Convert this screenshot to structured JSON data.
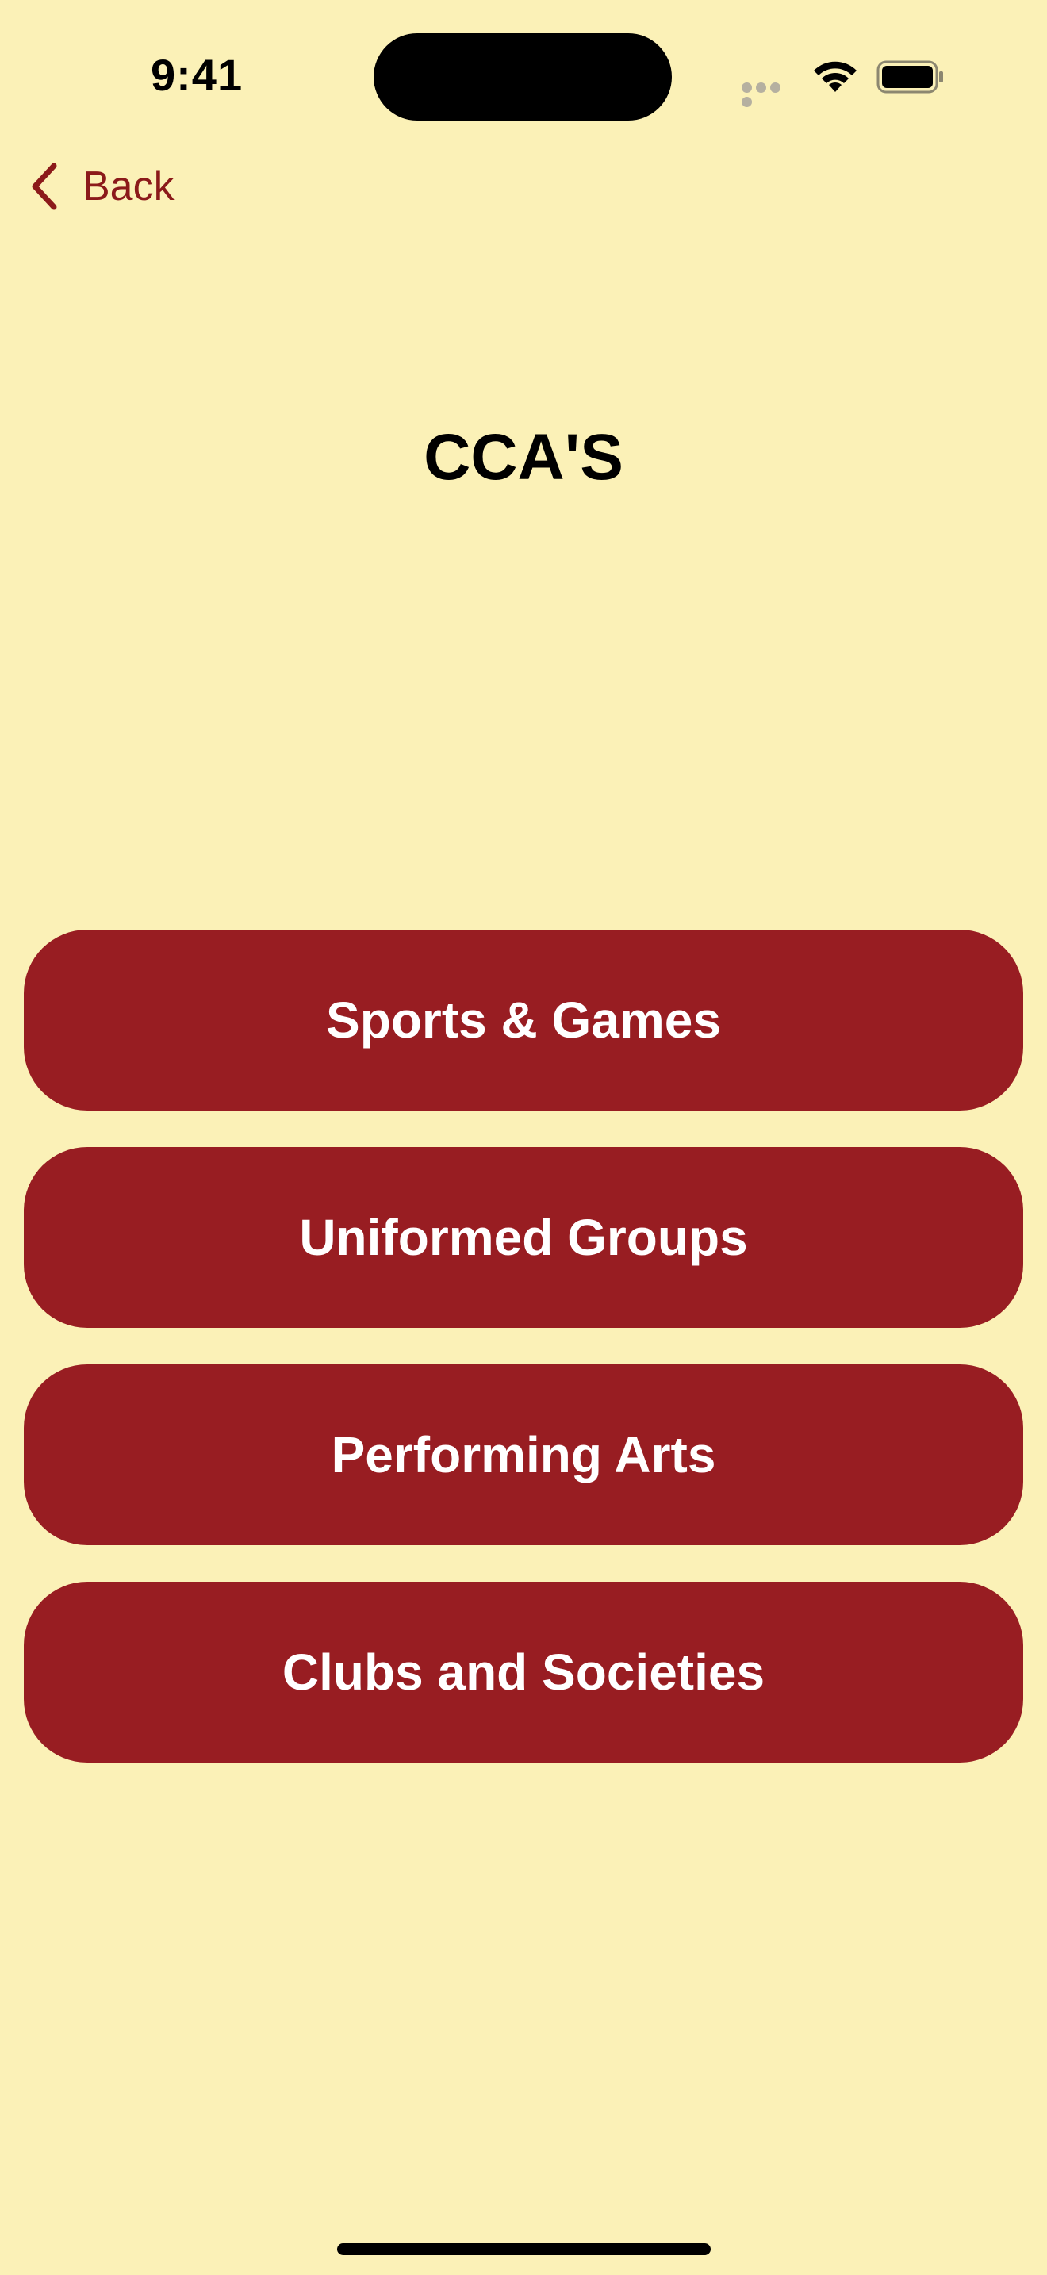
{
  "status_bar": {
    "time": "9:41",
    "icons": [
      "signal-icon",
      "wifi-icon",
      "battery-icon"
    ]
  },
  "nav": {
    "back_label": "Back",
    "back_icon": "chevron-left-icon"
  },
  "page": {
    "title": "CCA'S"
  },
  "categories": [
    {
      "label": "Sports & Games"
    },
    {
      "label": "Uniformed Groups"
    },
    {
      "label": "Performing Arts"
    },
    {
      "label": "Clubs and Societies"
    }
  ],
  "colors": {
    "background": "#FBF1B7",
    "button": "#981D22",
    "button_text": "#FFFFFF",
    "accent": "#8B1A1A",
    "title": "#000000"
  }
}
